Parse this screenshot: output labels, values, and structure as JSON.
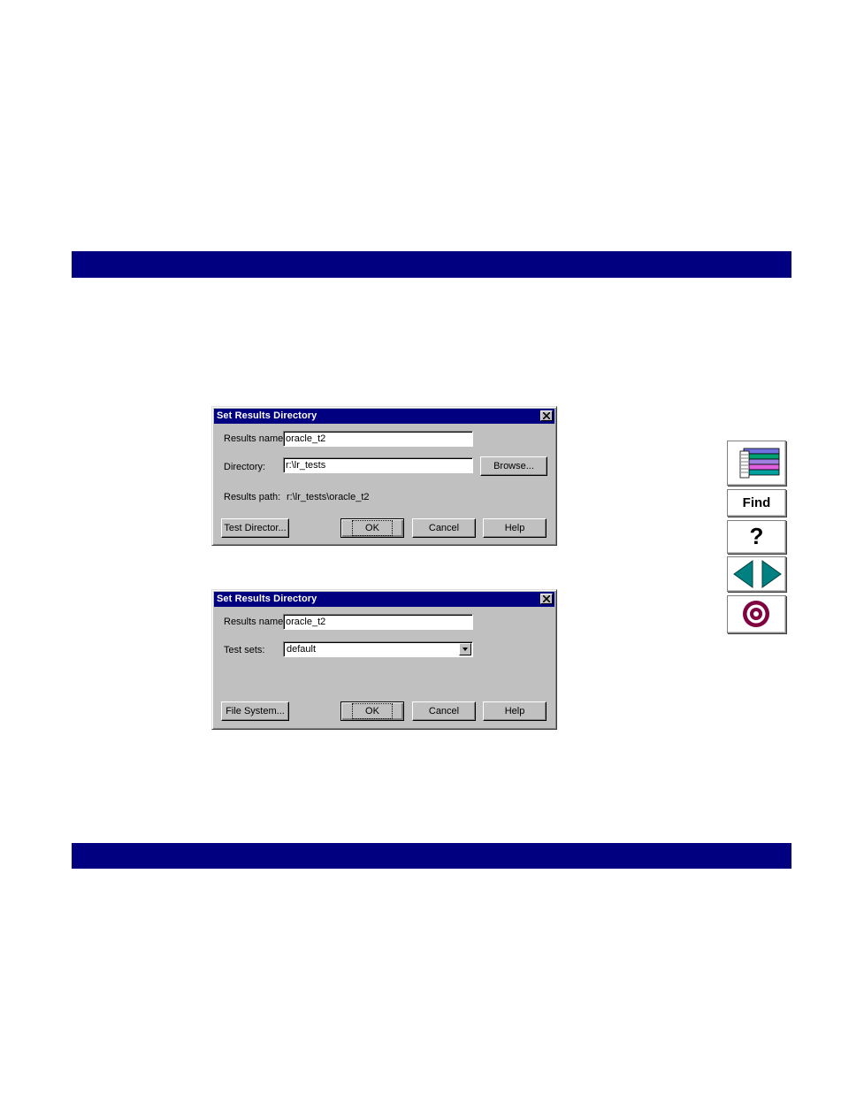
{
  "dialog1": {
    "title": "Set Results Directory",
    "results_name_label": "Results name:",
    "results_name_value": "oracle_t2",
    "directory_label": "Directory:",
    "directory_value": "r:\\lr_tests",
    "browse_button": "Browse...",
    "results_path_label": "Results path:",
    "results_path_value": "r:\\lr_tests\\oracle_t2",
    "test_director_button": "Test Director...",
    "ok_button": "OK",
    "cancel_button": "Cancel",
    "help_button": "Help"
  },
  "dialog2": {
    "title": "Set Results Directory",
    "results_name_label": "Results name:",
    "results_name_value": "oracle_t2",
    "test_sets_label": "Test sets:",
    "test_sets_value": "default",
    "file_system_button": "File System...",
    "ok_button": "OK",
    "cancel_button": "Cancel",
    "help_button": "Help"
  },
  "nav": {
    "find_label": "Find",
    "help_label": "?",
    "icons": [
      "books-icon",
      "find-icon",
      "help-icon",
      "back-arrow-icon",
      "forward-arrow-icon",
      "target-icon"
    ]
  },
  "colors": {
    "band": "#000080",
    "titlebar": "#000080",
    "dialog_face": "#c0c0c0",
    "nav_teal": "#008080",
    "nav_maroon": "#800040"
  }
}
